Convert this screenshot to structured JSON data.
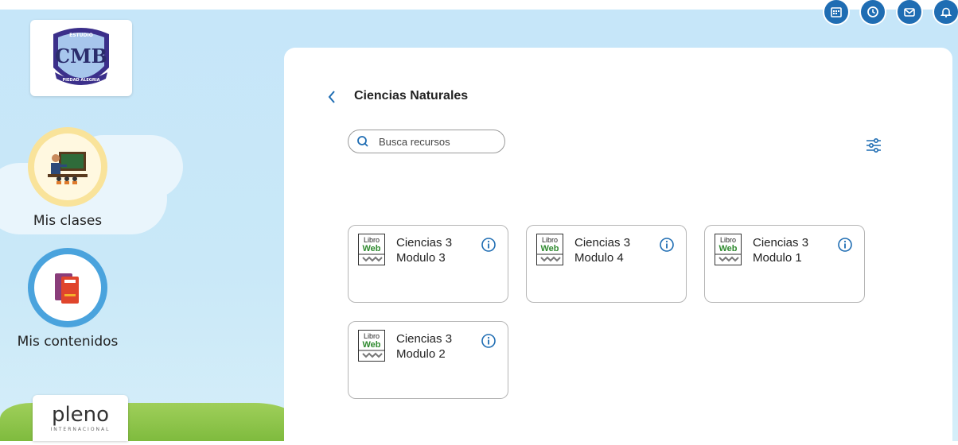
{
  "school_logo": {
    "arc_top": "ESTUDIO",
    "monogram": "CMB",
    "arc_bottom": "PIEDAD ALEGRIA"
  },
  "sidebar": {
    "items": [
      {
        "label": "Mis clases",
        "icon": "teacher-blackboard-icon",
        "ring_color": "#f9e39a"
      },
      {
        "label": "Mis contenidos",
        "icon": "books-icon",
        "ring_color": "#4aa3dd"
      }
    ]
  },
  "brand": {
    "name": "pleno",
    "tagline": "INTERNACIONAL"
  },
  "topbar": {
    "icons": [
      "calendar-icon",
      "clock-icon",
      "mail-icon",
      "bell-icon"
    ],
    "color": "#1f6db3"
  },
  "main": {
    "title": "Ciencias Naturales",
    "search": {
      "placeholder": "Busca recursos"
    },
    "resources": [
      {
        "title": "Ciencias 3",
        "subtitle": "Modulo 3",
        "badge": "Libro Web"
      },
      {
        "title": "Ciencias 3",
        "subtitle": "Modulo 4",
        "badge": "Libro Web"
      },
      {
        "title": "Ciencias 3",
        "subtitle": "Modulo 1",
        "badge": "Libro Web"
      },
      {
        "title": "Ciencias 3",
        "subtitle": "Modulo 2",
        "badge": "Libro Web"
      }
    ]
  },
  "colors": {
    "accent": "#1f6db3",
    "libro_green": "#2f8a2f"
  }
}
